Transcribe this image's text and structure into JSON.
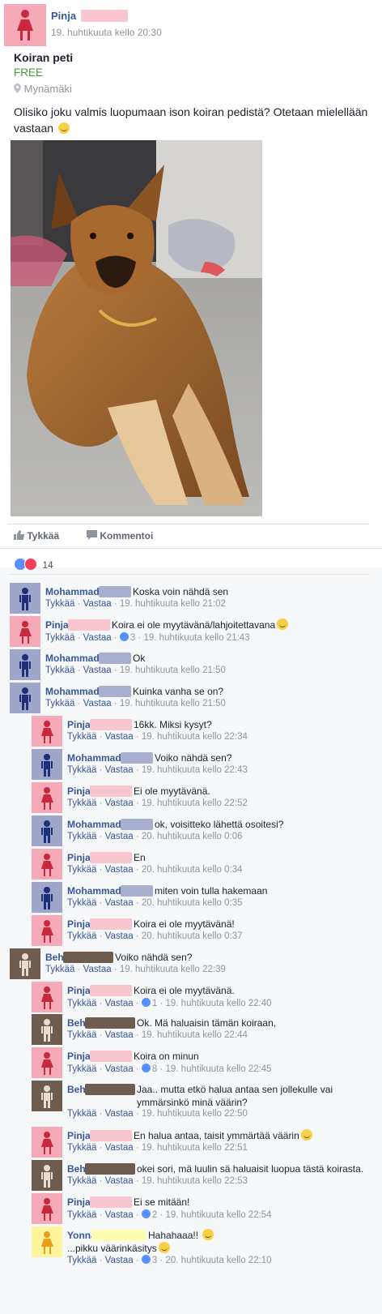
{
  "post": {
    "author": "Pinja",
    "timestamp": "19. huhtikuuta kello 20:30",
    "title": "Koiran peti",
    "price": "FREE",
    "location": "Mynämäki",
    "text": "Olisiko joku valmis luopumaan ison koiran pedistä? Otetaan mielellään vastaan",
    "location_icon": "map-pin-icon"
  },
  "actions": {
    "like_label": "Tykkää",
    "comment_label": "Kommentoi"
  },
  "reactions": {
    "count": "14"
  },
  "comment_actions": {
    "like": "Tykkää",
    "reply": "Vastaa"
  },
  "colors": {
    "pinja_avatar": "#f6a9b6",
    "mohammad_avatar": "#9ea6c9",
    "beh_avatar": "#6e5c4f",
    "yonna_avatar": "#fdf49c",
    "link": "#365899",
    "price": "#4b9b3a"
  },
  "comments": [
    {
      "name": "Mohammad",
      "text": "Koska voin nähdä sen",
      "likes": "",
      "time": "19. huhtikuuta kello 21:02"
    },
    {
      "name": "Pinja",
      "text": "Koira ei ole myytävänä/lahjoitettavana",
      "likes": "3",
      "time": "19. huhtikuuta kello 21:43"
    },
    {
      "name": "Mohammad",
      "text": "Ok",
      "likes": "",
      "time": "19. huhtikuuta kello 21:50"
    },
    {
      "name": "Mohammad",
      "text": "Kuinka vanha se on?",
      "likes": "",
      "time": "19. huhtikuuta kello 21:50"
    },
    {
      "name": "Pinja",
      "text": "16kk. Miksi kysyt?",
      "likes": "",
      "time": "19. huhtikuuta kello 22:34"
    },
    {
      "name": "Mohammad",
      "text": "Voiko nähdä sen?",
      "likes": "",
      "time": "19. huhtikuuta kello 22:43"
    },
    {
      "name": "Pinja",
      "text": "Ei ole myytävänä.",
      "likes": "",
      "time": "19. huhtikuuta kello 22:52"
    },
    {
      "name": "Mohammad",
      "text": "ok, voisitteko lähettä osoitesi?",
      "likes": "",
      "time": "20. huhtikuuta kello 0:06"
    },
    {
      "name": "Pinja",
      "text": "En",
      "likes": "",
      "time": "20. huhtikuuta kello 0:34"
    },
    {
      "name": "Mohammad",
      "text": "miten voin tulla hakemaan",
      "likes": "",
      "time": "20. huhtikuuta kello 0:35"
    },
    {
      "name": "Pinja",
      "text": "Koira ei ole myytävänä!",
      "likes": "",
      "time": "20. huhtikuuta kello 0:37"
    },
    {
      "name": "Beh",
      "text": "Voiko nähdä sen?",
      "likes": "",
      "time": "19. huhtikuuta kello 22:39"
    },
    {
      "name": "Pinja",
      "text": "Koira ei ole myytävänä.",
      "likes": "1",
      "time": "19. huhtikuuta kello 22:40"
    },
    {
      "name": "Beh",
      "text": "Ok. Mä haluaisin tämän koiraan,",
      "likes": "",
      "time": "19. huhtikuuta kello 22:44"
    },
    {
      "name": "Pinja",
      "text": "Koira on minun",
      "likes": "8",
      "time": "19. huhtikuuta kello 22:45"
    },
    {
      "name": "Beh",
      "text": "Jaa.. mutta etkö halua antaa sen jollekulle vai ymmärsinkö minä väärin?",
      "likes": "",
      "time": "19. huhtikuuta kello 22:50"
    },
    {
      "name": "Pinja",
      "text": "En halua antaa, taisit ymmärtää väärin",
      "likes": "",
      "time": "19. huhtikuuta kello 22:51"
    },
    {
      "name": "Beh",
      "text": "okei sori, mä luulin sä haluaisit luopua tästä koirasta.",
      "likes": "",
      "time": "19. huhtikuuta kello 22:53"
    },
    {
      "name": "Pinja",
      "text": "Ei se mitään!",
      "likes": "2",
      "time": "19. huhtikuuta kello 22:54"
    },
    {
      "name": "Yonna",
      "text": "Hahahaaa!!",
      "text2": "...pikku väärinkäsitys",
      "likes": "3",
      "time": "20. huhtikuuta kello 22:10"
    }
  ]
}
